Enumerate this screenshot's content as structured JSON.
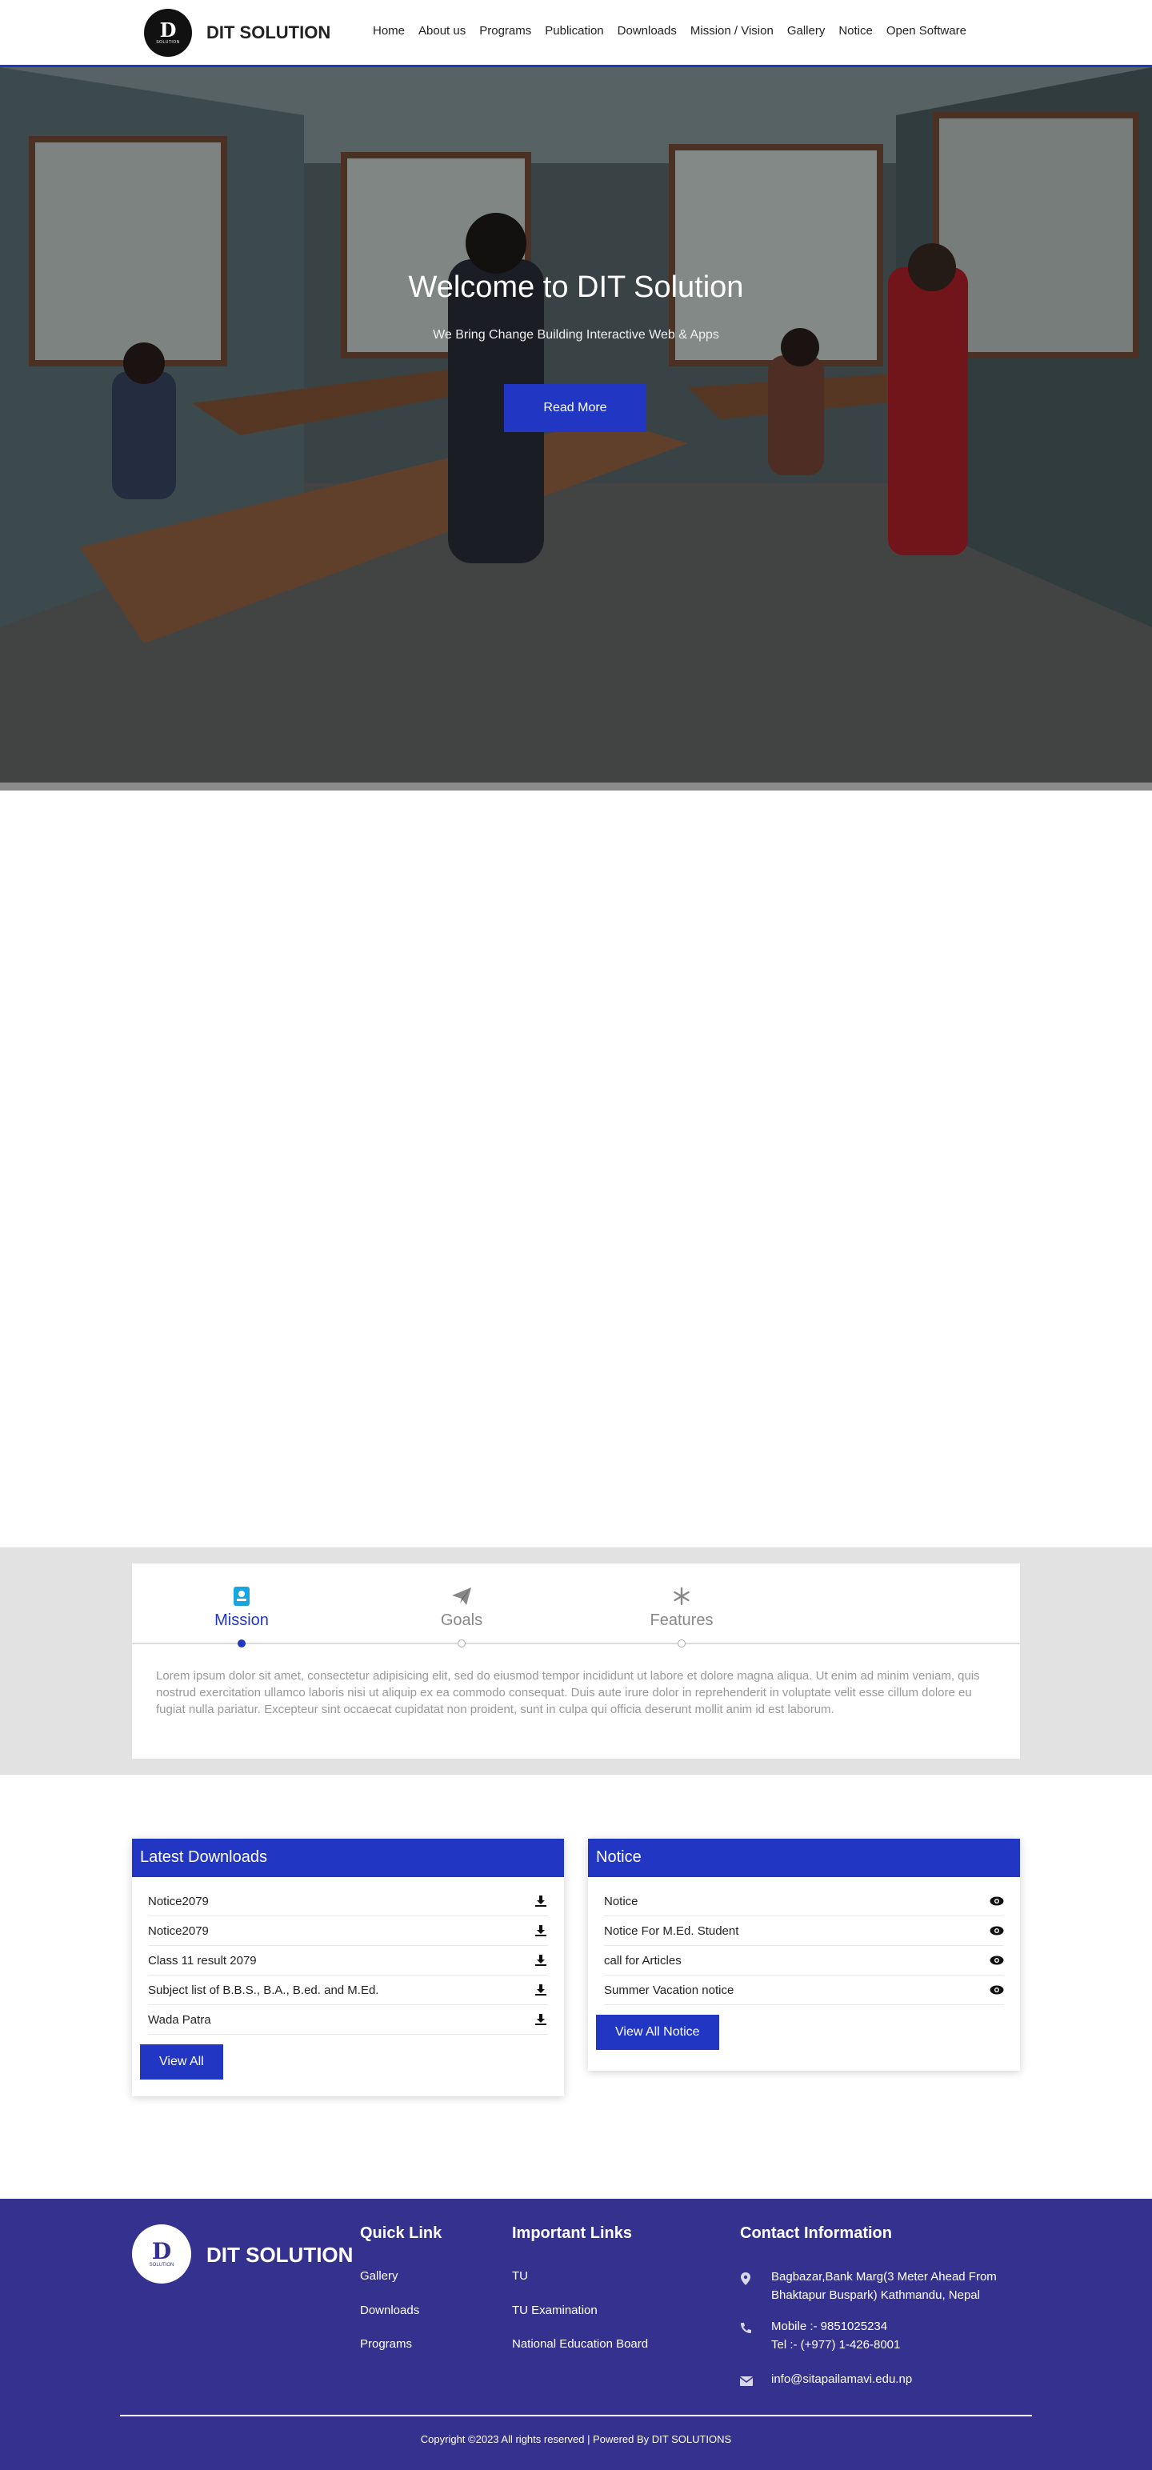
{
  "header": {
    "logo_text": "DIT SOLUTION",
    "logo_mono": "D",
    "logo_sub": "SOLUTION",
    "nav": [
      "Home",
      "About us",
      "Programs",
      "Publication",
      "Downloads",
      "Mission / Vision",
      "Gallery",
      "Notice",
      "Open Software"
    ]
  },
  "hero": {
    "title": "Welcome to DIT Solution",
    "subtitle": "We Bring Change Building Interactive Web & Apps",
    "button": "Read More"
  },
  "tabs": {
    "items": [
      {
        "label": "Mission",
        "icon": "id-badge-icon",
        "active": true
      },
      {
        "label": "Goals",
        "icon": "paper-plane-icon",
        "active": false
      },
      {
        "label": "Features",
        "icon": "snowflake-icon",
        "active": false
      }
    ],
    "text": "Lorem ipsum dolor sit amet, consectetur adipisicing elit, sed do eiusmod tempor incididunt ut labore et dolore magna aliqua. Ut enim ad minim veniam, quis nostrud exercitation ullamco laboris nisi ut aliquip ex ea commodo consequat. Duis aute irure dolor in reprehenderit in voluptate velit esse cillum dolore eu fugiat nulla pariatur. Excepteur sint occaecat cupidatat non proident, sunt in culpa qui officia deserunt mollit anim id est laborum."
  },
  "downloads": {
    "title": "Latest Downloads",
    "items": [
      "Notice2079",
      "Notice2079",
      "Class 11 result 2079",
      "Subject list of B.B.S., B.A., B.ed. and M.Ed.",
      "Wada Patra"
    ],
    "button": "View All"
  },
  "notice": {
    "title": "Notice",
    "items": [
      "Notice",
      "Notice For M.Ed. Student",
      "call for Articles",
      "Summer Vacation notice"
    ],
    "button": "View All Notice"
  },
  "footer": {
    "brand": "DIT SOLUTION",
    "logo_mono": "D",
    "logo_sub": "SOLUTION",
    "quick_title": "Quick Link",
    "quick_links": [
      "Gallery",
      "Downloads",
      "Programs"
    ],
    "important_title": "Important Links",
    "important_links": [
      "TU",
      "TU Examination",
      "National Education Board"
    ],
    "contact_title": "Contact Information",
    "address_line1": "Bagbazar,Bank Marg(3 Meter Ahead From",
    "address_line2": "Bhaktapur Buspark) Kathmandu, Nepal",
    "mobile": "Mobile :- 9851025234",
    "tel": "Tel :- (+977) 1-426-8001",
    "email": "info@sitapailamavi.edu.np",
    "copyright": "Copyright ©2023 All rights reserved | Powered By DIT SOLUTIONS"
  },
  "colors": {
    "primary": "#2236c4",
    "footer_bg": "#35318f",
    "section_bg": "#e2e2e2"
  }
}
